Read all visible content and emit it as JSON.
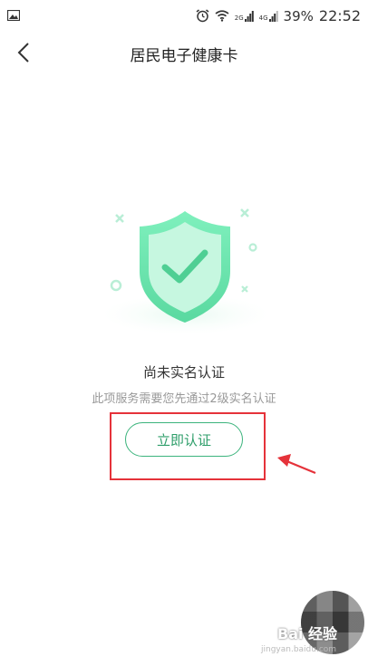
{
  "status_bar": {
    "battery": "39%",
    "time": "22:52",
    "signal_label_1": "2G",
    "signal_label_2": "4G"
  },
  "header": {
    "title": "居民电子健康卡"
  },
  "main": {
    "status_title": "尚未实名认证",
    "status_desc": "此项服务需要您先通过2级实名认证",
    "verify_button": "立即认证"
  },
  "watermark": {
    "logo_text": "Bai 经验",
    "url": "jingyan.baidu.com"
  },
  "colors": {
    "accent_green": "#3cb47d",
    "shield_green": "#6fe3b0",
    "annotation_red": "#e5323a"
  }
}
